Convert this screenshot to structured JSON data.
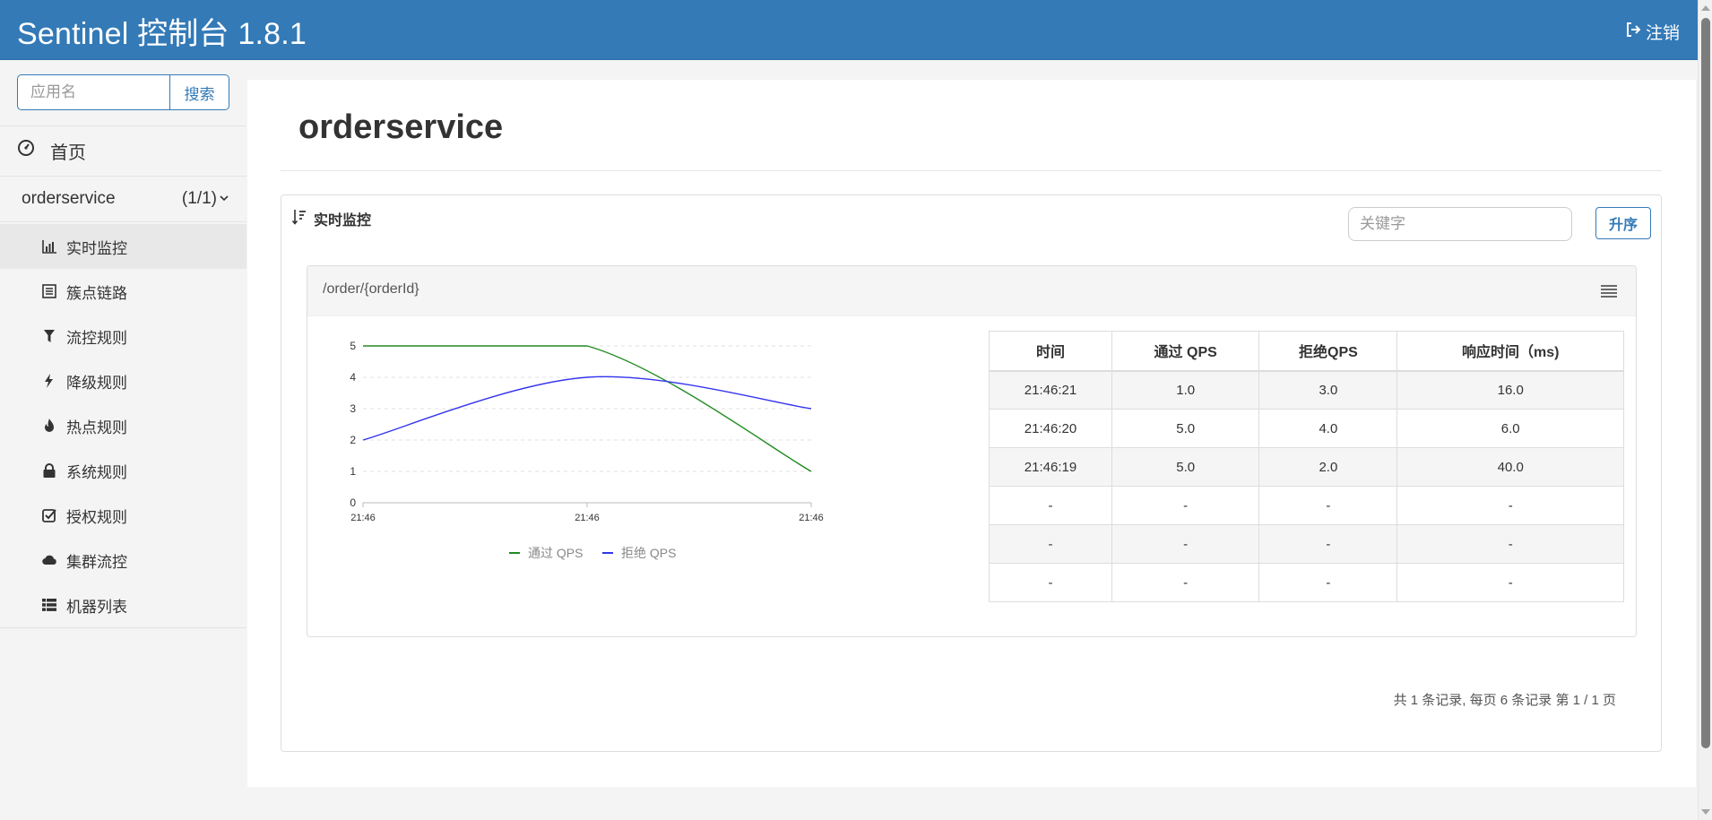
{
  "header": {
    "brand": "Sentinel 控制台 1.8.1",
    "logout_label": "注销"
  },
  "sidebar": {
    "search_placeholder": "应用名",
    "search_button": "搜索",
    "home_label": "首页",
    "app": {
      "name": "orderservice",
      "count": "(1/1)"
    },
    "menu": [
      {
        "label": "实时监控",
        "icon": "bar-chart-icon",
        "active": true
      },
      {
        "label": "簇点链路",
        "icon": "list-icon"
      },
      {
        "label": "流控规则",
        "icon": "filter-icon"
      },
      {
        "label": "降级规则",
        "icon": "flash-icon"
      },
      {
        "label": "热点规则",
        "icon": "fire-icon"
      },
      {
        "label": "系统规则",
        "icon": "lock-icon"
      },
      {
        "label": "授权规则",
        "icon": "check-icon"
      },
      {
        "label": "集群流控",
        "icon": "cloud-icon"
      },
      {
        "label": "机器列表",
        "icon": "table-list-icon"
      }
    ]
  },
  "main": {
    "title": "orderservice",
    "panel_title": "实时监控",
    "keyword_placeholder": "关键字",
    "sort_button": "升序",
    "card": {
      "resource": "/order/{orderId}",
      "table": {
        "headers": [
          "时间",
          "通过 QPS",
          "拒绝QPS",
          "响应时间（ms)"
        ],
        "rows": [
          [
            "21:46:21",
            "1.0",
            "3.0",
            "16.0"
          ],
          [
            "21:46:20",
            "5.0",
            "4.0",
            "6.0"
          ],
          [
            "21:46:19",
            "5.0",
            "2.0",
            "40.0"
          ],
          [
            "-",
            "-",
            "-",
            "-"
          ],
          [
            "-",
            "-",
            "-",
            "-"
          ],
          [
            "-",
            "-",
            "-",
            "-"
          ]
        ]
      }
    },
    "pager_text": "共 1 条记录, 每页 6 条记录 第 1 / 1 页"
  },
  "chart_data": {
    "type": "line",
    "x": [
      "21:46",
      "21:46",
      "21:46"
    ],
    "series": [
      {
        "name": "通过 QPS",
        "values": [
          5,
          5,
          1
        ],
        "color": "#228b22"
      },
      {
        "name": "拒绝 QPS",
        "values": [
          2,
          4,
          3
        ],
        "color": "#3333ee"
      }
    ],
    "ylim": [
      0,
      5
    ],
    "yticks": [
      0,
      1,
      2,
      3,
      4,
      5
    ],
    "grid": true,
    "legend": "bottom"
  }
}
